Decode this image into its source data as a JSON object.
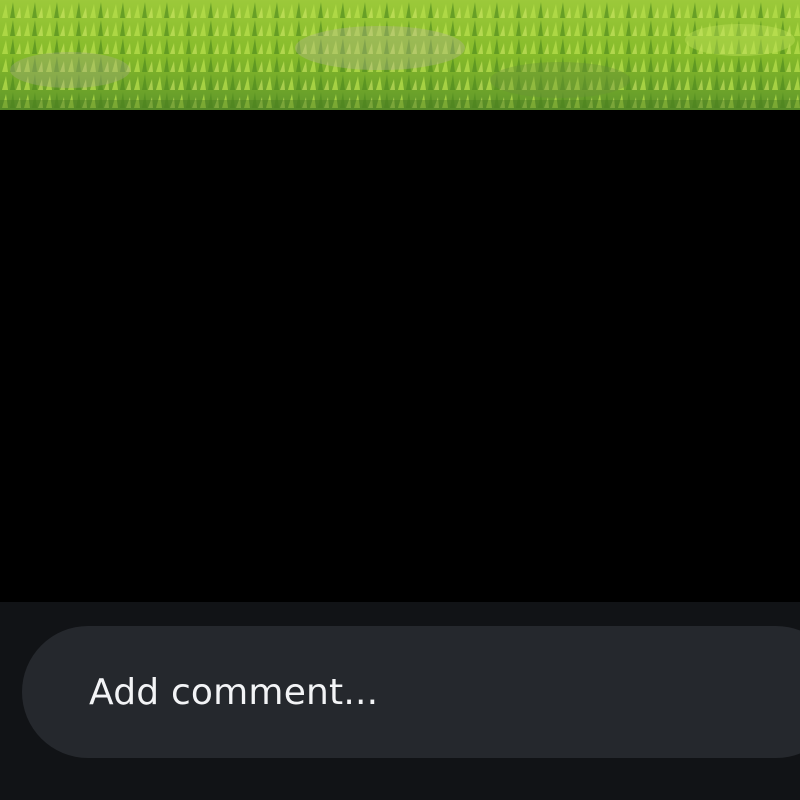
{
  "media": {
    "image_description_icon": "grass-photo"
  },
  "comment": {
    "placeholder": "Add comment..."
  },
  "colors": {
    "background": "#000000",
    "comment_bar": "#111316",
    "input_pill": "#25282d",
    "text": "#f3f4f6",
    "grass_dark": "#5f8f1f",
    "grass_light": "#a8d33a"
  }
}
